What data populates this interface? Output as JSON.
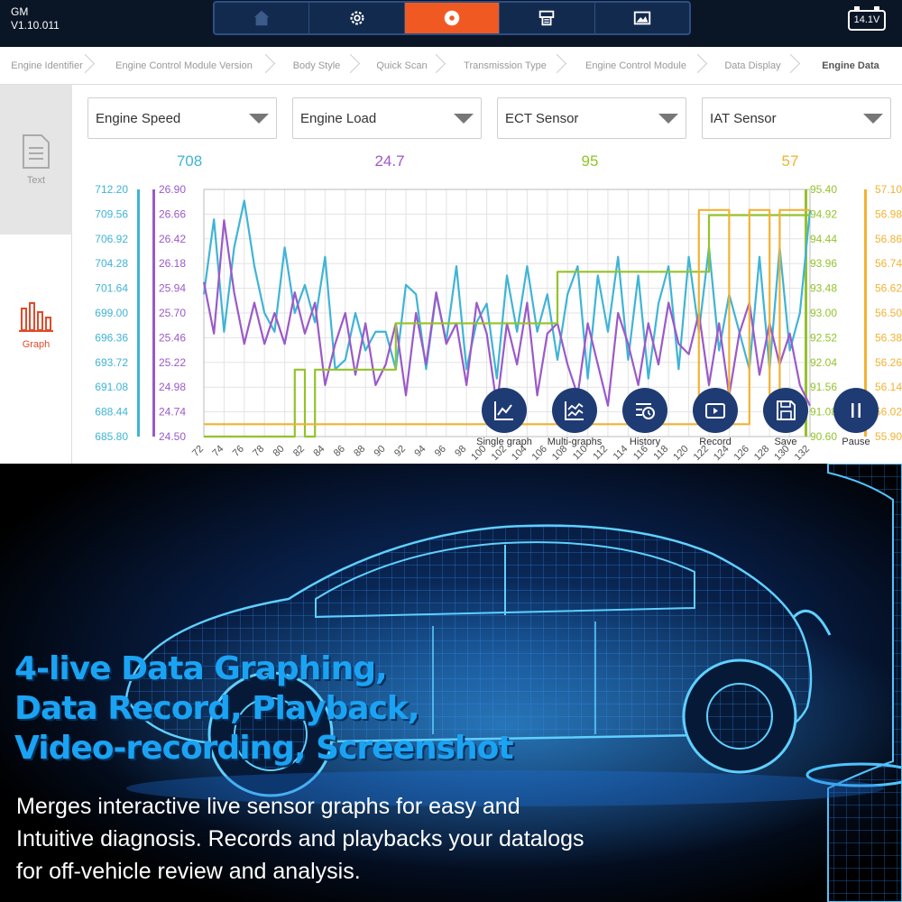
{
  "header": {
    "make": "GM",
    "version": "V1.10.011",
    "battery": "14.1V",
    "tabs": [
      {
        "icon": "home-icon",
        "active": false
      },
      {
        "icon": "gear-icon",
        "active": false
      },
      {
        "icon": "record-icon",
        "active": true
      },
      {
        "icon": "printer-icon",
        "active": false
      },
      {
        "icon": "image-icon",
        "active": false
      }
    ]
  },
  "breadcrumb": [
    "Engine Identifier",
    "Engine Control Module Version",
    "Body Style",
    "Quick Scan",
    "Transmission Type",
    "Engine Control Module",
    "Data Display",
    "Engine Data"
  ],
  "sidebar": {
    "text_label": "Text",
    "graph_label": "Graph"
  },
  "selectors": [
    {
      "label": "Engine Speed",
      "value": "708",
      "color": "#3fb4d6"
    },
    {
      "label": "Engine Load",
      "value": "24.7",
      "color": "#9b59c9"
    },
    {
      "label": "ECT Sensor",
      "value": "95",
      "color": "#93c32a"
    },
    {
      "label": "IAT Sensor",
      "value": "57",
      "color": "#f2b233"
    }
  ],
  "chart_data": {
    "type": "line",
    "x": [
      72,
      73,
      74,
      75,
      76,
      77,
      78,
      79,
      80,
      81,
      82,
      83,
      84,
      85,
      86,
      87,
      88,
      89,
      90,
      91,
      92,
      93,
      94,
      95,
      96,
      97,
      98,
      99,
      100,
      101,
      102,
      103,
      104,
      105,
      106,
      107,
      108,
      109,
      110,
      111,
      112,
      113,
      114,
      115,
      116,
      117,
      118,
      119,
      120,
      121,
      122,
      123,
      124,
      125,
      126,
      127,
      128,
      129,
      130,
      131,
      132
    ],
    "x_ticks": [
      "72",
      "74",
      "76",
      "78",
      "80",
      "82",
      "84",
      "86",
      "88",
      "90",
      "92",
      "94",
      "96",
      "98",
      "100",
      "102",
      "104",
      "106",
      "108",
      "110",
      "112",
      "114",
      "116",
      "118",
      "120",
      "122",
      "124",
      "126",
      "128",
      "130",
      "132"
    ],
    "series": [
      {
        "name": "Engine Speed",
        "color": "#3fb4d6",
        "axis": "left1",
        "ticks": [
          "712.20",
          "709.56",
          "706.92",
          "704.28",
          "701.64",
          "699.00",
          "696.36",
          "693.72",
          "691.08",
          "688.44",
          "685.80"
        ],
        "ylim": [
          685.8,
          712.2
        ],
        "values": [
          701.0,
          709.0,
          697.0,
          706.0,
          711.0,
          704.0,
          699.0,
          697.0,
          706.0,
          699.0,
          702.0,
          698.0,
          705.0,
          693.0,
          694.0,
          699.0,
          695.0,
          697.0,
          697.0,
          693.0,
          702.0,
          701.0,
          693.0,
          701.0,
          696.0,
          704.0,
          693.0,
          698.0,
          700.0,
          692.0,
          703.0,
          697.0,
          704.0,
          697.0,
          701.0,
          694.0,
          701.0,
          704.0,
          692.0,
          703.0,
          697.0,
          705.0,
          694.0,
          703.0,
          692.0,
          700.0,
          704.0,
          693.0,
          705.0,
          697.0,
          706.0,
          695.0,
          701.0,
          697.0,
          693.0,
          705.0,
          693.0,
          706.0,
          695.0,
          699.0,
          710.0
        ]
      },
      {
        "name": "Engine Load",
        "color": "#9b59c9",
        "axis": "left2",
        "ticks": [
          "26.90",
          "26.66",
          "26.42",
          "26.18",
          "25.94",
          "25.70",
          "25.46",
          "25.22",
          "24.98",
          "24.74",
          "24.50"
        ],
        "ylim": [
          24.5,
          26.9
        ],
        "values": [
          26.0,
          25.5,
          26.6,
          25.9,
          25.4,
          25.8,
          25.4,
          25.7,
          25.4,
          25.9,
          25.5,
          25.8,
          25.0,
          25.4,
          25.7,
          25.1,
          25.6,
          25.0,
          25.2,
          25.6,
          24.9,
          25.7,
          25.2,
          25.9,
          25.4,
          25.6,
          25.0,
          25.8,
          25.5,
          24.8,
          25.6,
          25.2,
          25.8,
          24.9,
          25.5,
          25.6,
          25.2,
          24.9,
          25.6,
          25.2,
          24.8,
          25.7,
          25.4,
          25.0,
          25.6,
          25.2,
          25.8,
          25.4,
          25.3,
          25.7,
          25.0,
          25.6,
          24.9,
          25.5,
          25.8,
          25.1,
          25.6,
          25.2,
          25.5,
          25.0,
          24.8
        ]
      },
      {
        "name": "ECT Sensor",
        "color": "#93c32a",
        "axis": "right1",
        "ticks": [
          "95.40",
          "94.92",
          "94.44",
          "93.96",
          "93.48",
          "93.00",
          "92.52",
          "92.04",
          "91.56",
          "91.08",
          "90.60"
        ],
        "ylim": [
          90.6,
          95.4
        ],
        "values": [
          90.6,
          90.6,
          90.6,
          90.6,
          90.6,
          90.6,
          90.6,
          90.6,
          90.6,
          91.9,
          90.6,
          91.9,
          91.9,
          91.9,
          91.9,
          91.9,
          91.9,
          91.9,
          91.9,
          92.8,
          92.8,
          92.8,
          92.8,
          92.8,
          92.8,
          92.8,
          92.8,
          92.8,
          92.8,
          92.8,
          92.8,
          92.8,
          92.8,
          92.8,
          92.8,
          93.8,
          93.8,
          93.8,
          93.8,
          93.8,
          93.8,
          93.8,
          93.8,
          93.8,
          93.8,
          93.8,
          93.8,
          93.8,
          93.8,
          93.8,
          94.9,
          94.9,
          94.9,
          94.9,
          94.9,
          94.9,
          94.9,
          94.9,
          94.9,
          94.9,
          94.9
        ]
      },
      {
        "name": "IAT Sensor",
        "color": "#f2b233",
        "axis": "right2",
        "ticks": [
          "57.10",
          "56.98",
          "56.86",
          "56.74",
          "56.62",
          "56.50",
          "56.38",
          "56.26",
          "56.14",
          "56.02",
          "55.90"
        ],
        "ylim": [
          55.9,
          57.1
        ],
        "values": [
          55.96,
          55.96,
          55.96,
          55.96,
          55.96,
          55.96,
          55.96,
          55.96,
          55.96,
          55.96,
          55.96,
          55.96,
          55.96,
          55.96,
          55.96,
          55.96,
          55.96,
          55.96,
          55.96,
          55.96,
          55.96,
          55.96,
          55.96,
          55.96,
          55.96,
          55.96,
          55.96,
          55.96,
          55.96,
          55.96,
          55.96,
          55.96,
          55.96,
          55.96,
          55.96,
          55.96,
          55.96,
          55.96,
          55.96,
          55.96,
          55.96,
          55.96,
          55.96,
          55.96,
          55.96,
          55.96,
          55.96,
          55.96,
          55.96,
          57.0,
          57.0,
          57.0,
          55.96,
          55.96,
          57.0,
          57.0,
          55.96,
          57.0,
          57.0,
          57.0,
          57.0
        ]
      }
    ],
    "grid": true
  },
  "toolbar": [
    {
      "label": "Single graph",
      "icon": "single-graph-icon"
    },
    {
      "label": "Multi-graphs",
      "icon": "multi-graph-icon"
    },
    {
      "label": "History",
      "icon": "history-icon"
    },
    {
      "label": "Record",
      "icon": "record-video-icon"
    },
    {
      "label": "Save",
      "icon": "save-icon"
    },
    {
      "label": "Pause",
      "icon": "pause-icon"
    }
  ],
  "hero": {
    "headline": [
      "4-live Data Graphing,",
      "Data Record, Playback,",
      "Video-recording, Screenshot"
    ],
    "body": [
      "Merges interactive live sensor graphs for easy and",
      "Intuitive diagnosis. Records and playbacks your datalogs",
      "for off-vehicle review and analysis."
    ]
  }
}
